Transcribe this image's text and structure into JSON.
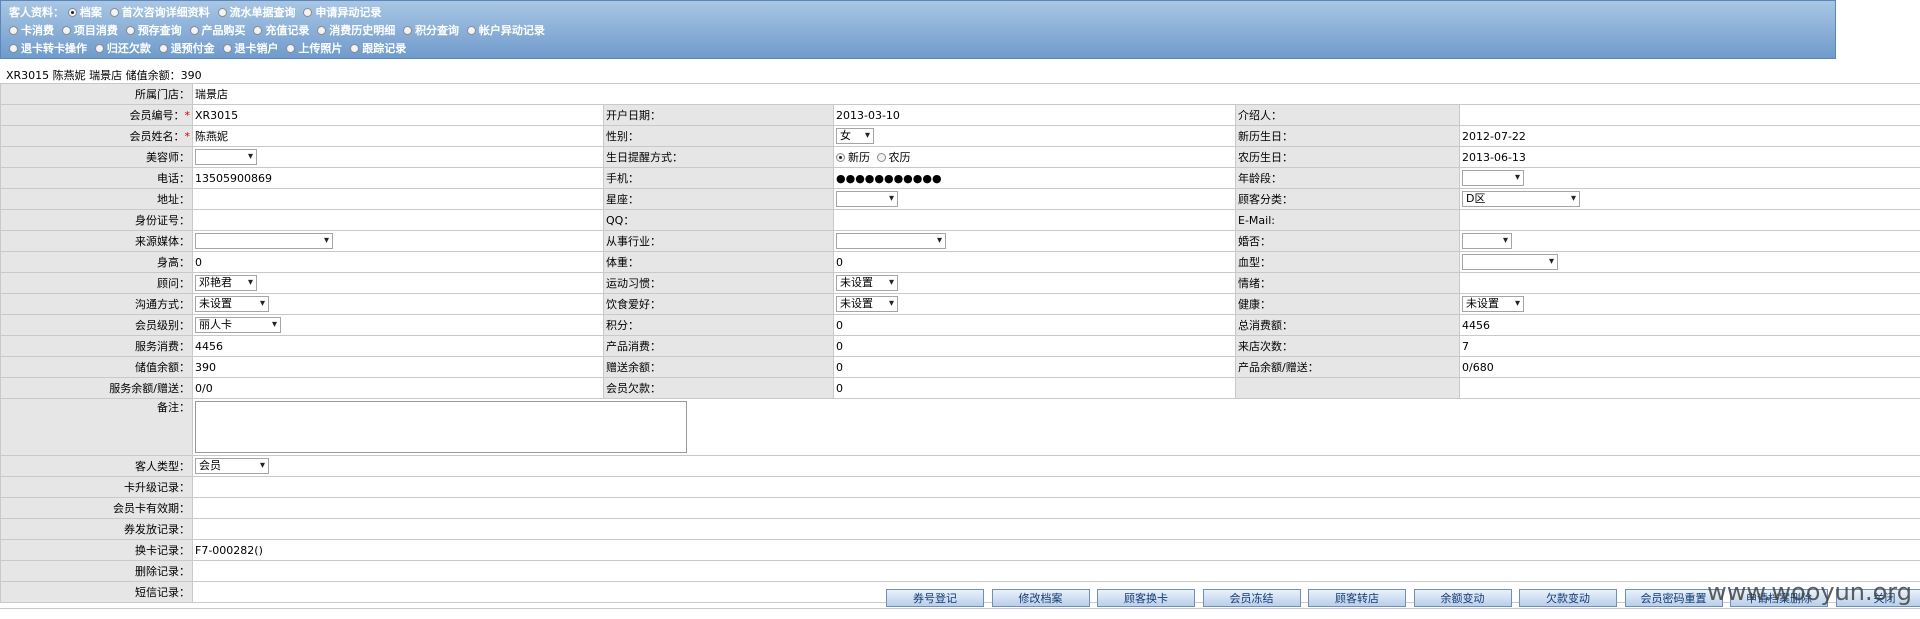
{
  "nav": {
    "row1_label": "客人资料：",
    "row1": [
      {
        "label": "档案",
        "checked": true
      },
      {
        "label": "首次咨询详细资料",
        "checked": false
      },
      {
        "label": "流水单据查询",
        "checked": false
      },
      {
        "label": "申请异动记录",
        "checked": false
      }
    ],
    "row2": [
      {
        "label": "卡消费",
        "checked": false
      },
      {
        "label": "项目消费",
        "checked": false
      },
      {
        "label": "预存查询",
        "checked": false
      },
      {
        "label": "产品购买",
        "checked": false
      },
      {
        "label": "充值记录",
        "checked": false
      },
      {
        "label": "消费历史明细",
        "checked": false
      },
      {
        "label": "积分查询",
        "checked": false
      },
      {
        "label": "帐户异动记录",
        "checked": false
      }
    ],
    "row3": [
      {
        "label": "退卡转卡操作",
        "checked": false
      },
      {
        "label": "归还欠款",
        "checked": false
      },
      {
        "label": "退预付金",
        "checked": false
      },
      {
        "label": "退卡销户",
        "checked": false
      },
      {
        "label": "上传照片",
        "checked": false
      },
      {
        "label": "跟踪记录",
        "checked": false
      }
    ]
  },
  "summary": "XR3015 陈燕妮 瑞景店 储值余额：390",
  "form": {
    "store": {
      "label": "所属门店：",
      "value": "瑞景店"
    },
    "member_no": {
      "label": "会员编号：",
      "value": "XR3015"
    },
    "open_date": {
      "label": "开户日期：",
      "value": "2013-03-10"
    },
    "referrer": {
      "label": "介绍人：",
      "value": ""
    },
    "member_name": {
      "label": "会员姓名：",
      "value": "陈燕妮"
    },
    "gender": {
      "label": "性别：",
      "value": "女"
    },
    "solar_birthday": {
      "label": "新历生日：",
      "value": "2012-07-22"
    },
    "beautician": {
      "label": "美容师：",
      "value": ""
    },
    "birthday_remind": {
      "label": "生日提醒方式：",
      "option_solar": "新历",
      "option_lunar": "农历"
    },
    "lunar_birthday": {
      "label": "农历生日：",
      "value": "2013-06-13"
    },
    "phone": {
      "label": "电话：",
      "value": "13505900869"
    },
    "mobile": {
      "label": "手机：",
      "value": "●●●●●●●●●●●"
    },
    "age_group": {
      "label": "年龄段：",
      "value": ""
    },
    "address": {
      "label": "地址：",
      "value": ""
    },
    "zodiac": {
      "label": "星座：",
      "value": ""
    },
    "customer_class": {
      "label": "顾客分类：",
      "value": "D区"
    },
    "id_no": {
      "label": "身份证号：",
      "value": ""
    },
    "qq": {
      "label": "QQ：",
      "value": ""
    },
    "email": {
      "label": "E-Mail:",
      "value": ""
    },
    "source": {
      "label": "来源媒体：",
      "value": ""
    },
    "industry": {
      "label": "从事行业：",
      "value": ""
    },
    "married": {
      "label": "婚否：",
      "value": ""
    },
    "height": {
      "label": "身高：",
      "value": "0"
    },
    "weight": {
      "label": "体重：",
      "value": "0"
    },
    "blood": {
      "label": "血型：",
      "value": ""
    },
    "consultant": {
      "label": "顾问：",
      "value": "邓艳君"
    },
    "exercise": {
      "label": "运动习惯：",
      "value": "未设置"
    },
    "mood": {
      "label": "情绪：",
      "value": ""
    },
    "contact_way": {
      "label": "沟通方式：",
      "value": "未设置"
    },
    "diet": {
      "label": "饮食爱好：",
      "value": "未设置"
    },
    "health": {
      "label": "健康：",
      "value": "未设置"
    },
    "level": {
      "label": "会员级别：",
      "value": "丽人卡"
    },
    "points": {
      "label": "积分：",
      "value": "0"
    },
    "total_spend": {
      "label": "总消费额：",
      "value": "4456"
    },
    "service_spend": {
      "label": "服务消费：",
      "value": "4456"
    },
    "product_spend": {
      "label": "产品消费：",
      "value": "0"
    },
    "visits": {
      "label": "来店次数：",
      "value": "7"
    },
    "stored_balance": {
      "label": "储值余额：",
      "value": "390"
    },
    "gift_balance": {
      "label": "赠送余额：",
      "value": "0"
    },
    "product_balance": {
      "label": "产品余额/赠送：",
      "value": "0/680"
    },
    "service_balance": {
      "label": "服务余额/赠送：",
      "value": "0/0"
    },
    "debt": {
      "label": "会员欠款：",
      "value": "0"
    },
    "remark": {
      "label": "备注："
    },
    "customer_type": {
      "label": "客人类型：",
      "value": "会员"
    },
    "upgrade_log": {
      "label": "卡升级记录：",
      "value": ""
    },
    "card_valid": {
      "label": "会员卡有效期：",
      "value": ""
    },
    "coupon_log": {
      "label": "券发放记录：",
      "value": ""
    },
    "card_change_log": {
      "label": "换卡记录：",
      "value": "F7-000282()"
    },
    "delete_log": {
      "label": "删除记录：",
      "value": ""
    },
    "sms_log": {
      "label": "短信记录：",
      "value": ""
    }
  },
  "buttons": [
    "券号登记",
    "修改档案",
    "顾客换卡",
    "会员冻结",
    "顾客转店",
    "余额变动",
    "欠款变动",
    "会员密码重置",
    "申请档案删除",
    "关闭"
  ],
  "watermark": "www.wooyun.org"
}
